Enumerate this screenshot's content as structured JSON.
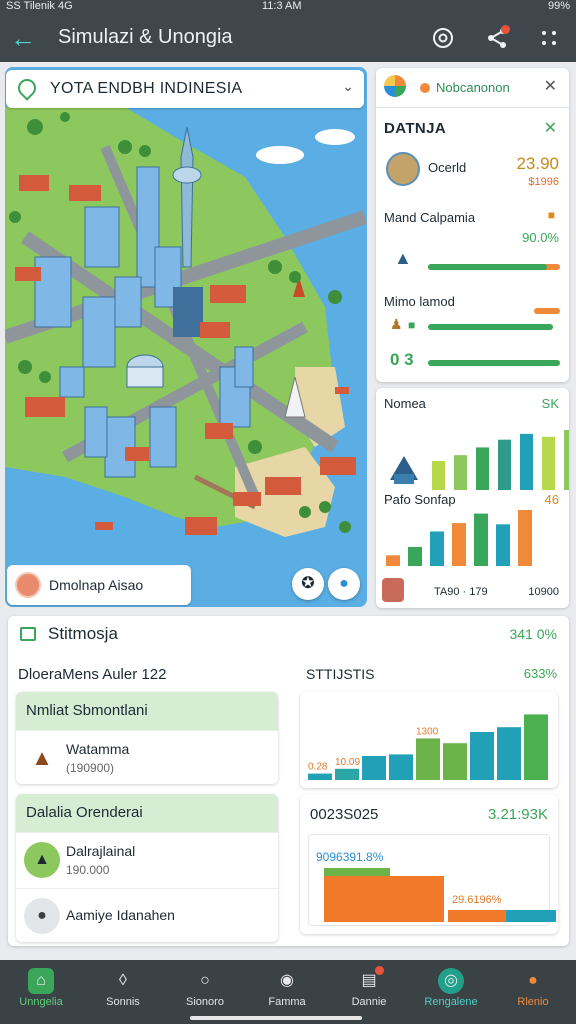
{
  "status_bar": {
    "left": "SS Tilenik 4G",
    "time": "11:3 AM",
    "right": "99%"
  },
  "app_bar": {
    "title": "Simulazi & Unongia",
    "icons": [
      "back-arrow-icon",
      "settings-icon",
      "share-icon",
      "more-icon"
    ]
  },
  "map": {
    "header": "YOTA ENDBH INDINESIA",
    "footer_label": "Dmolnap Aisao",
    "colors": {
      "water": "#5aaee3",
      "land": "#8cc85e",
      "road": "#8e969c"
    }
  },
  "panel_top": {
    "header": "Nobcanonon",
    "section_title": "DATNJA",
    "row1": {
      "label": "Ocerld",
      "value": "23.90",
      "sub": "$1996"
    },
    "row2": {
      "label": "Mand Calpamia",
      "value": "90.0%",
      "progress": 0.9
    },
    "row3": {
      "label": "Mimo lamod",
      "value": "0 3",
      "progress": 0.95
    }
  },
  "panel_chart": {
    "title1": "Nomea",
    "value1": "SK",
    "title2": "Pafo Sonfap",
    "value2": "46",
    "footer_left": "TA90 · 179",
    "footer_right": "10900"
  },
  "main": {
    "title": "Stitmosja",
    "title_value": "341 0%",
    "subtitle": "DloeraMens Auler 122",
    "stat_label": "STTIJSTIS",
    "stat_value": "633%",
    "group1": {
      "header": "Nmliat Sbmontlani",
      "items": [
        {
          "name": "Watamma",
          "sub": "(190900)"
        }
      ]
    },
    "group2": {
      "header": "Dalalia Orenderai",
      "items": [
        {
          "name": "Dalrajlainal",
          "sub": "190.000"
        },
        {
          "name": "Aamiye Idanahen",
          "sub": ""
        }
      ]
    },
    "chart2": {
      "label": "0023S025",
      "value": "3.21:93K",
      "pct": "9096391.8%",
      "small": "29.6196%"
    }
  },
  "chart_data": [
    {
      "type": "bar",
      "values": [
        30,
        36,
        44,
        52,
        58,
        55,
        62
      ],
      "series_colors": [
        "#b6d84a",
        "#8cc85e",
        "#3aa65a",
        "#2e9a88",
        "#22a0b8"
      ],
      "note": "Nomea bars"
    },
    {
      "type": "bar",
      "values": [
        18,
        32,
        58,
        72,
        88,
        70,
        94
      ],
      "series_colors": [
        "#f08a3a",
        "#3aa65a",
        "#22a0b8"
      ],
      "note": "Pafo Sonfap bars"
    },
    {
      "type": "bar",
      "ylim": [
        0,
        100
      ],
      "values": [
        8,
        14,
        30,
        32,
        52,
        46,
        60,
        66,
        82
      ],
      "data_labels": [
        "0.28",
        "10.09",
        "",
        "",
        "1300",
        "",
        "",
        "",
        ""
      ]
    }
  ],
  "bottom_nav": [
    {
      "label": "Unngelia",
      "icon": "home-icon",
      "active": true
    },
    {
      "label": "Sonnis",
      "icon": "explore-icon"
    },
    {
      "label": "Sionoro",
      "icon": "ribbon-icon"
    },
    {
      "label": "Famma",
      "icon": "shield-icon"
    },
    {
      "label": "Dannie",
      "icon": "document-icon"
    },
    {
      "label": "Rengalene",
      "icon": "target-icon"
    },
    {
      "label": "Rlenio",
      "icon": "person-icon"
    }
  ]
}
